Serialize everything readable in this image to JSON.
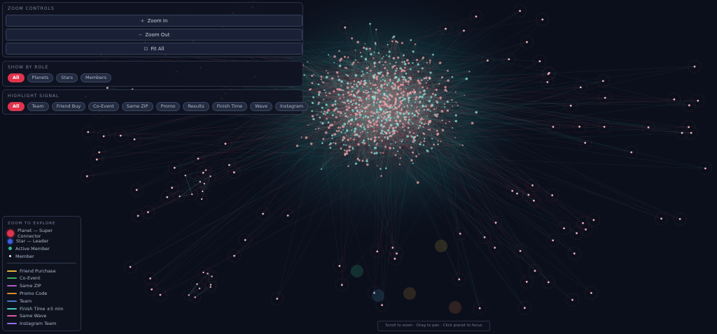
{
  "zoom_controls": {
    "title": "ZOOM CONTROLS",
    "zoom_in": "Zoom In",
    "zoom_out": "Zoom Out",
    "fit_all": "Fit All"
  },
  "role_filter": {
    "title": "SHOW BY ROLE",
    "options": [
      "All",
      "Planets",
      "Stars",
      "Members"
    ],
    "selected": "All"
  },
  "signal_filter": {
    "title": "HIGHLIGHT SIGNAL",
    "options": [
      "All",
      "Team",
      "Friend Buy",
      "Co-Event",
      "Same ZIP",
      "Promo",
      "Results",
      "Finish Time",
      "Wave",
      "Instagram"
    ],
    "selected": "All"
  },
  "legend": {
    "title": "ZOOM TO EXPLORE",
    "nodes": [
      {
        "label": "Planet — Super Connector",
        "color": "#e0344e"
      },
      {
        "label": "Star — Leader",
        "color": "#3d5fe0"
      },
      {
        "label": "Active Member",
        "color": "#2fbf8f"
      },
      {
        "label": "Member",
        "color": "#e8ecf4"
      }
    ],
    "edges": [
      {
        "label": "Friend Purchase",
        "color": "#e6b33a"
      },
      {
        "label": "Co-Event",
        "color": "#3fae5a"
      },
      {
        "label": "Same ZIP",
        "color": "#b05cc8"
      },
      {
        "label": "Promo Code",
        "color": "#e08a2a"
      },
      {
        "label": "Team",
        "color": "#4a78c8"
      },
      {
        "label": "Finish Time ±5 min",
        "color": "#49c9c0"
      },
      {
        "label": "Same Wave",
        "color": "#d95aa0"
      },
      {
        "label": "Instagram Team",
        "color": "#9a6cf0"
      }
    ]
  },
  "hint": "Scroll to zoom · Drag to pan · Click planet to focus",
  "colors": {
    "accent": "#e0344e",
    "edge_teal": "#3fbfb3",
    "edge_red": "#d5505f",
    "background": "#0b0f1c"
  },
  "icons": {
    "zoom_in": "plus-icon",
    "zoom_out": "minus-icon",
    "fit_all": "fit-icon"
  }
}
